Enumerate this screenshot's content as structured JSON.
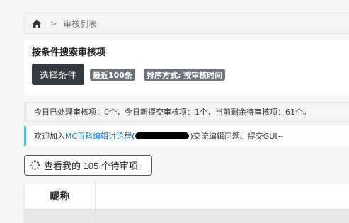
{
  "breadcrumb": {
    "home_icon": "home-icon",
    "separator": ">",
    "current": "审核列表"
  },
  "search_panel": {
    "title": "按条件搜索审核项",
    "select_button": "选择条件",
    "tags": [
      "最近100条",
      "排序方式: 按审核时间"
    ]
  },
  "stats": {
    "text": "今日已处理审核项：0个，今日新提交审核项：1个，当前剩余待审核项：61个。"
  },
  "info": {
    "prefix": "欢迎加入",
    "link": "MC百科编辑讨论群",
    "open_paren": "(",
    "close_paren": ")",
    "suffix": " 交流编辑问题、提交GUI~"
  },
  "pending_button": {
    "icon": "spinner-icon",
    "label": "查看我的 105 个待审项"
  },
  "table": {
    "headers": [
      "昵称"
    ]
  },
  "colors": {
    "dark_button": "#343a40",
    "tag": "#6c757d",
    "info_border": "#5bc0de",
    "link": "#0b6bbf"
  }
}
